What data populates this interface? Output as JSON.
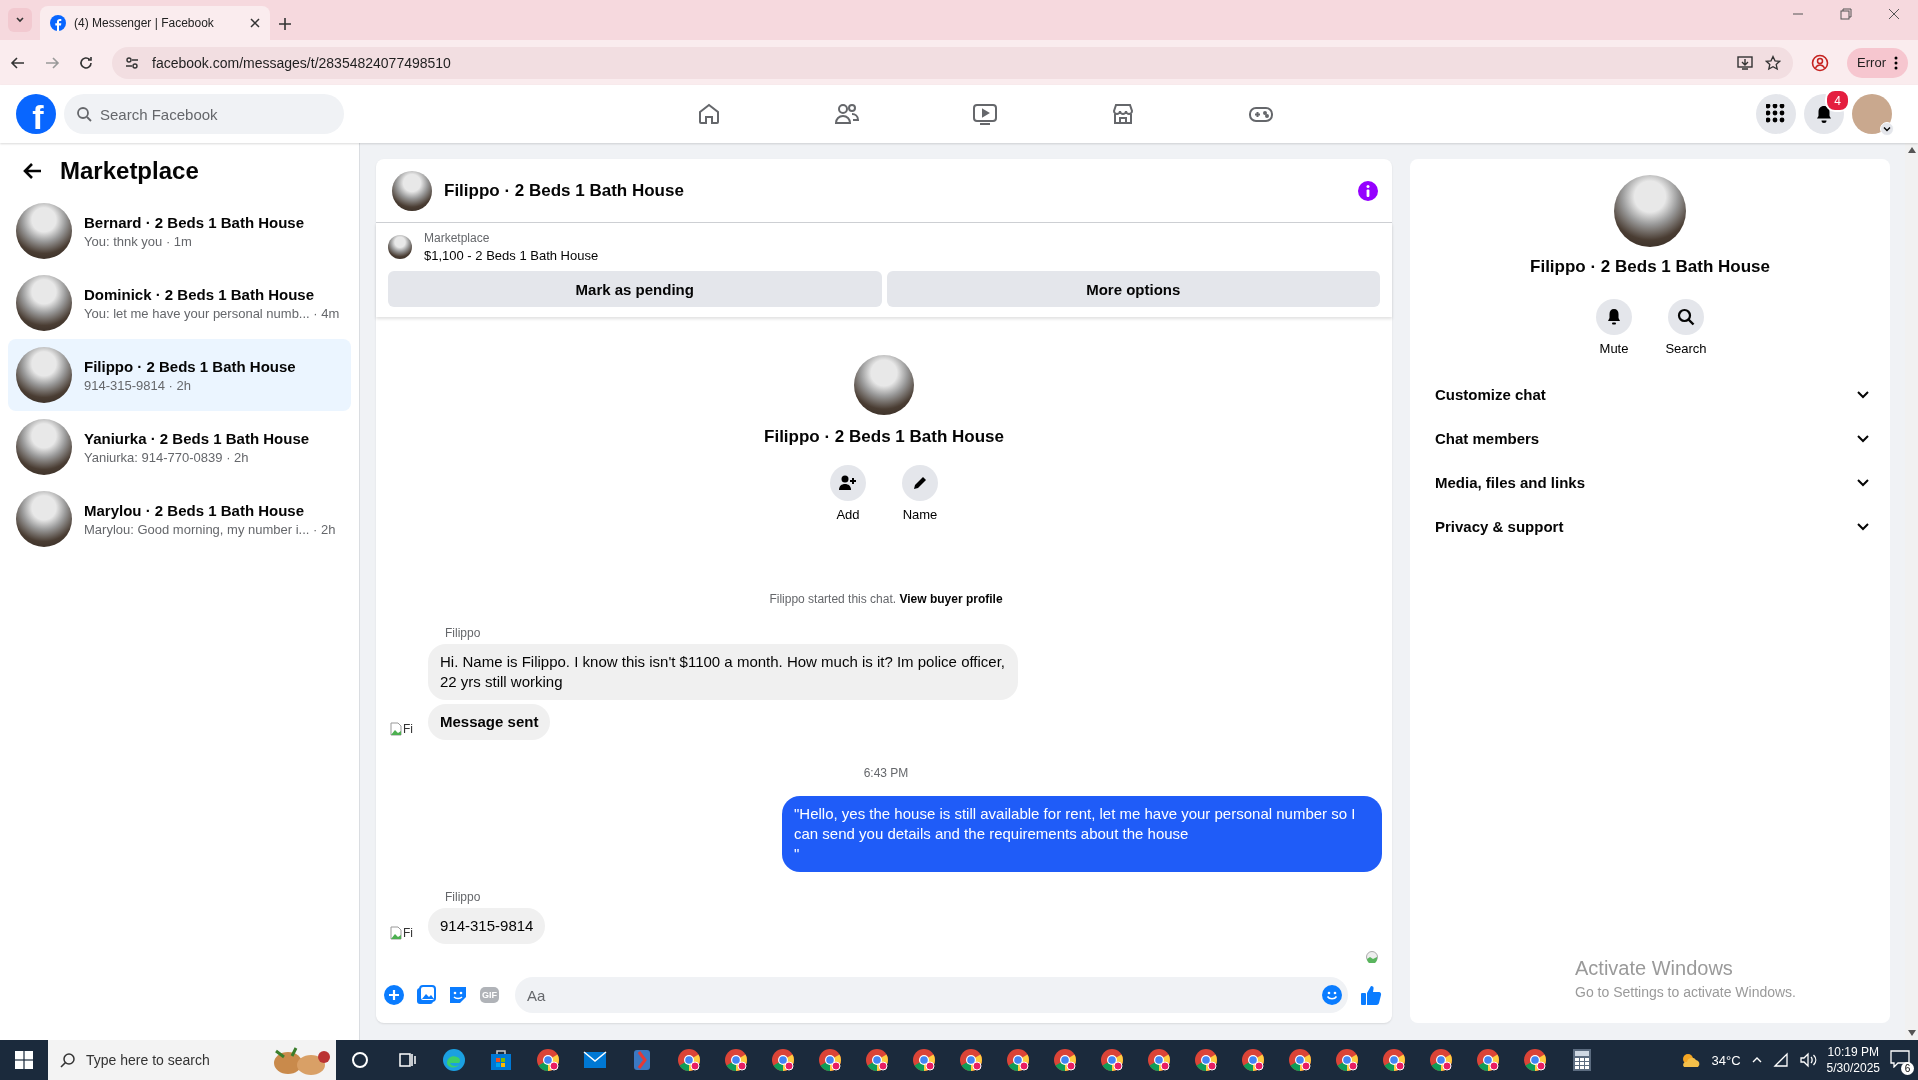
{
  "browser": {
    "tab_title": "(4) Messenger | Facebook",
    "url": "facebook.com/messages/t/28354824077498510",
    "profile_button": "Error"
  },
  "nav": {
    "logo": "f",
    "search_placeholder": "Search Facebook",
    "notification_count": "4"
  },
  "sidebar": {
    "title": "Marketplace",
    "conversations": [
      {
        "name": "Bernard · 2 Beds 1 Bath House",
        "preview": "You: thnk you · 1m",
        "selected": false
      },
      {
        "name": "Dominick · 2 Beds 1 Bath House",
        "preview": "You: let me have your personal numb... · 4m",
        "selected": false
      },
      {
        "name": "Filippo · 2 Beds 1 Bath House",
        "preview": "914-315-9814 · 2h",
        "selected": true
      },
      {
        "name": "Yaniurka · 2 Beds 1 Bath House",
        "preview": "Yaniurka: 914-770-0839 · 2h",
        "selected": false
      },
      {
        "name": "Marylou · 2 Beds 1 Bath House",
        "preview": "Marylou: Good morning, my number i... · 2h",
        "selected": false
      }
    ]
  },
  "chat": {
    "title": "Filippo · 2 Beds 1 Bath House",
    "listing": {
      "source": "Marketplace",
      "title": "$1,100 - 2 Beds 1 Bath House"
    },
    "listing_buttons": [
      "Mark as pending",
      "More options"
    ],
    "intro": {
      "name": "Filippo · 2 Beds 1 Bath House",
      "actions": [
        {
          "kind": "add",
          "label": "Add"
        },
        {
          "kind": "name",
          "label": "Name"
        }
      ]
    },
    "messages": [
      {
        "kind": "system",
        "text": "Filippo started this chat.",
        "link": "View buyer profile"
      },
      {
        "kind": "received",
        "sender": "Filippo",
        "avatar_alt": "Fi",
        "bubbles": [
          {
            "text": "Hi. Name is Filippo. I know this isn't $1100 a month. How much is it? Im police officer, 22 yrs still working",
            "bold": false
          },
          {
            "text": "Message sent",
            "bold": true
          }
        ]
      },
      {
        "kind": "time",
        "text": "6:43 PM"
      },
      {
        "kind": "sent",
        "text": "\"Hello, yes the house is still available for rent, let me have your personal number so I can send you details and the requirements about the house\n\""
      },
      {
        "kind": "received",
        "sender": "Filippo",
        "avatar_alt": "Fi",
        "bubbles": [
          {
            "text": "914-315-9814",
            "bold": false
          }
        ]
      }
    ],
    "composer": {
      "gif_label": "GIF",
      "placeholder": "Aa"
    }
  },
  "info": {
    "name": "Filippo · 2 Beds 1 Bath House",
    "actions": [
      {
        "kind": "mute",
        "label": "Mute"
      },
      {
        "kind": "search",
        "label": "Search"
      }
    ],
    "sections": [
      {
        "label": "Customize chat",
        "expanded": false
      },
      {
        "label": "Chat members",
        "expanded": false
      },
      {
        "label": "Media, files and links",
        "expanded": false
      },
      {
        "label": "Privacy & support",
        "expanded": false
      }
    ]
  },
  "activation_notice": {
    "title": "Activate Windows",
    "text": "Go to Settings to activate Windows."
  },
  "taskbar": {
    "search_placeholder": "Type here to search",
    "apps": [
      {
        "kind": "cortana"
      },
      {
        "kind": "taskview"
      },
      {
        "kind": "edge"
      },
      {
        "kind": "store"
      },
      {
        "kind": "chrome"
      },
      {
        "kind": "mail"
      },
      {
        "kind": "app"
      },
      {
        "kind": "chrome"
      },
      {
        "kind": "chrome"
      },
      {
        "kind": "chrome"
      },
      {
        "kind": "chrome"
      },
      {
        "kind": "chrome"
      },
      {
        "kind": "chrome"
      },
      {
        "kind": "chrome"
      },
      {
        "kind": "chrome"
      },
      {
        "kind": "chrome"
      },
      {
        "kind": "chrome"
      },
      {
        "kind": "chrome"
      },
      {
        "kind": "chrome"
      },
      {
        "kind": "chrome"
      },
      {
        "kind": "chrome"
      },
      {
        "kind": "chrome"
      },
      {
        "kind": "chrome"
      },
      {
        "kind": "chrome"
      },
      {
        "kind": "chrome"
      },
      {
        "kind": "chrome"
      },
      {
        "kind": "calculator"
      }
    ],
    "temperature": "34°C",
    "time": "10:19 PM",
    "date": "5/30/2025",
    "notification_count": "6"
  }
}
